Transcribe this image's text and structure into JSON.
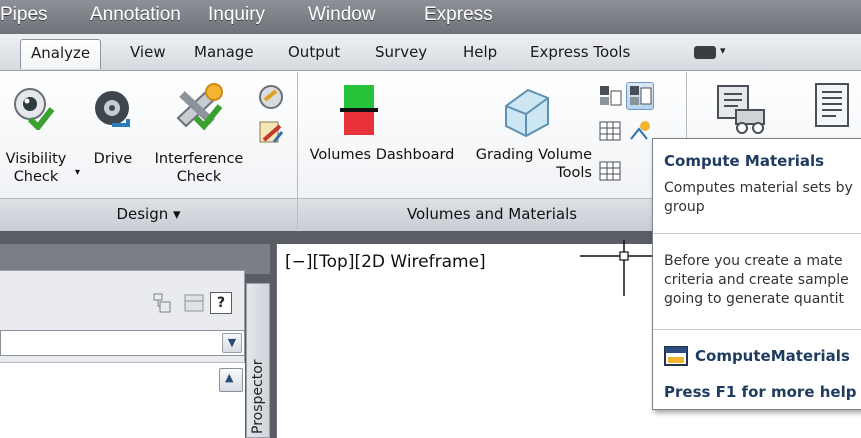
{
  "menubar": {
    "items": [
      "Pipes",
      "Annotation",
      "Inquiry",
      "Window",
      "Express"
    ]
  },
  "tabs": {
    "items": [
      "Analyze",
      "View",
      "Manage",
      "Output",
      "Survey",
      "Help",
      "Express Tools"
    ],
    "active": "Analyze"
  },
  "ribbon": {
    "design_panel": {
      "title": "Design",
      "buttons": [
        "Visibility\nCheck",
        "Drive",
        "Interference\nCheck"
      ]
    },
    "volumes_panel": {
      "title": "Volumes and Materials",
      "buttons": [
        "Volumes Dashboard",
        "Grading Volume\nTools"
      ]
    }
  },
  "viewport": {
    "label": "[−][Top][2D Wireframe]"
  },
  "palette": {
    "side_tab": "Prospector"
  },
  "tooltip": {
    "title": "Compute Materials",
    "description_lines": [
      "Computes material sets by",
      "group"
    ],
    "detail_lines": [
      "Before you create a mate",
      "criteria and create sample",
      "going to generate quantit"
    ],
    "command": "ComputeMaterials",
    "help": "Press F1 for more help"
  },
  "colors": {
    "menubar": "#7d8086",
    "ribbon": "#f2f4f7",
    "tooltip_title": "#1f3b5f",
    "selected_button": "#b9d3ee"
  }
}
